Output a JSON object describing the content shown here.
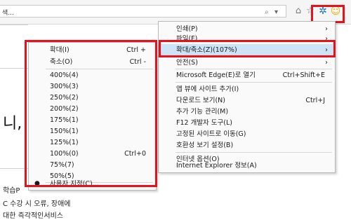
{
  "toolbar": {
    "address_text": "색...",
    "search_btn": "⌕",
    "dropdown_btn": "▾",
    "home_icon": "⌂",
    "star_icon": "☆",
    "gear_icon": "✲",
    "smile_icon": "☺"
  },
  "page": {
    "big_char": "니,",
    "text1": "학습P",
    "text2": "C 수강 시 오류, 장애에",
    "text3": "대한 즉각적인서비스"
  },
  "main_menu": [
    {
      "label": "인쇄(P)",
      "arrow": "›"
    },
    {
      "label": "파일(F)",
      "arrow": "›"
    },
    {
      "label": "확대/축소(Z)(107%)",
      "arrow": "›"
    },
    {
      "label": "안전(S)",
      "arrow": "›"
    },
    {
      "label": "Microsoft Edge(E)로 열기",
      "shortcut": "Ctrl+Shift+E"
    },
    {
      "label": "앱 뷰에 사이트 추가(I)"
    },
    {
      "label": "다운로드 보기(N)",
      "shortcut": "Ctrl+J"
    },
    {
      "label": "추가 기능 관리(M)"
    },
    {
      "label": "F12 개발자 도구(L)"
    },
    {
      "label": "고정된 사이트로 이동(G)"
    },
    {
      "label": "호환성 보기 설정(B)"
    },
    {
      "label": "인터넷 옵션(O)"
    },
    {
      "label": "Internet Explorer 정보(A)"
    }
  ],
  "zoom_menu": [
    {
      "label": "확대(I)",
      "shortcut": "Ctrl +"
    },
    {
      "label": "축소(O)",
      "shortcut": "Ctrl -"
    },
    {
      "label": "400%(4)"
    },
    {
      "label": "300%(3)"
    },
    {
      "label": "250%(2)"
    },
    {
      "label": "200%(2)"
    },
    {
      "label": "175%(1)"
    },
    {
      "label": "150%(1)"
    },
    {
      "label": "125%(1)"
    },
    {
      "label": "100%(0)",
      "shortcut": "Ctrl+0"
    },
    {
      "label": "75%(7)"
    },
    {
      "label": "50%(5)"
    },
    {
      "label": "사용자 지정(C)...",
      "bullet": "●"
    }
  ],
  "colors": {
    "highlight_border": "#e8101a",
    "menu_highlight": "#cfe3f7",
    "gear": "#1a73c8",
    "smile": "#f2b200"
  }
}
